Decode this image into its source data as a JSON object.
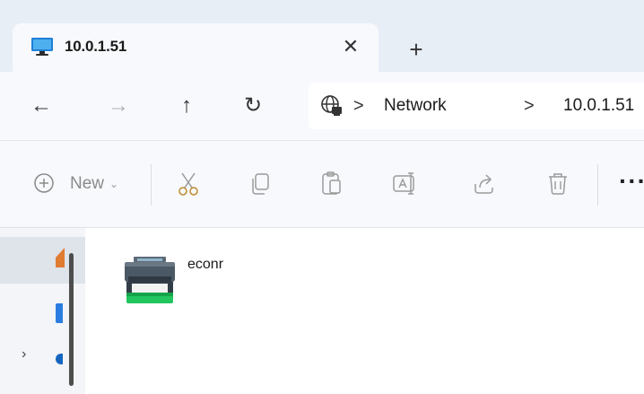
{
  "tab": {
    "title": "10.0.1.51",
    "close_glyph": "✕",
    "icon": "monitor-icon"
  },
  "new_tab_glyph": "+",
  "nav": {
    "back_glyph": "←",
    "forward_glyph": "→",
    "up_glyph": "↑",
    "refresh_glyph": "↻"
  },
  "address": {
    "icon": "network-globe-icon",
    "separator": ">",
    "crumbs": [
      "Network",
      "10.0.1.51"
    ]
  },
  "commands": {
    "new_label": "New",
    "new_chevron": "⌄",
    "icons": [
      "cut-icon",
      "copy-icon",
      "paste-icon",
      "rename-icon",
      "share-icon",
      "delete-icon"
    ],
    "more_glyph": "···"
  },
  "content": {
    "items": [
      {
        "label": "econr",
        "icon": "printer-icon"
      }
    ]
  },
  "colors": {
    "tabstrip_bg": "#e8eef6",
    "toolbar_bg": "#f7f9fc",
    "printer_green": "#22c55e",
    "printer_dark": "#3d4a57"
  }
}
